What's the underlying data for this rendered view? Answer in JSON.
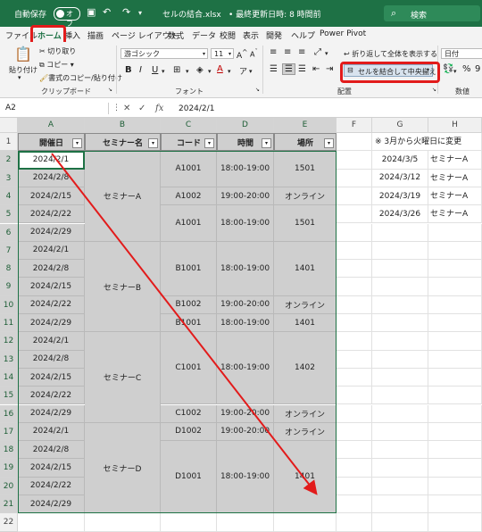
{
  "titlebar": {
    "autosave_label": "自動保存",
    "autosave_state": "オフ",
    "filename": "セルの結合.xlsx",
    "modified": "• 最終更新日時: 8 時間前",
    "search_label": "検索"
  },
  "menu": [
    "ファイル",
    "ホーム",
    "挿入",
    "描画",
    "ページ レイアウト",
    "数式",
    "データ",
    "校閲",
    "表示",
    "開発",
    "ヘルプ",
    "Power Pivot"
  ],
  "ribbon": {
    "paste": "貼り付け",
    "cut": "切り取り",
    "copy": "コピー",
    "format_painter": "書式のコピー/貼り付け",
    "group_clipboard": "クリップボード",
    "font_name": "游ゴシック",
    "font_size": "11",
    "group_font": "フォント",
    "wrap_text": "折り返して全体を表示する",
    "merge_center": "セルを結合して中央揃え",
    "group_alignment": "配置",
    "number_format": "日付",
    "group_number": "数値"
  },
  "formula_bar": {
    "name_box": "A2",
    "formula": "2024/2/1"
  },
  "columns": [
    "A",
    "B",
    "C",
    "D",
    "E",
    "F",
    "G",
    "H"
  ],
  "rows": [
    "1",
    "2",
    "3",
    "4",
    "5",
    "6",
    "7",
    "8",
    "9",
    "10",
    "11",
    "12",
    "13",
    "14",
    "15",
    "16",
    "17",
    "18",
    "19",
    "20",
    "21",
    "22"
  ],
  "headers": [
    "開催日",
    "セミナー名",
    "コード",
    "時間",
    "場所"
  ],
  "dates": [
    "2024/2/1",
    "2024/2/8",
    "2024/2/15",
    "2024/2/22",
    "2024/2/29",
    "2024/2/1",
    "2024/2/8",
    "2024/2/15",
    "2024/2/22",
    "2024/2/29",
    "2024/2/1",
    "2024/2/8",
    "2024/2/15",
    "2024/2/22",
    "2024/2/29",
    "2024/2/1",
    "2024/2/8",
    "2024/2/15",
    "2024/2/22",
    "2024/2/29"
  ],
  "seminars": [
    "セミナーA",
    "セミナーB",
    "セミナーC",
    "セミナーD"
  ],
  "codes": [
    "A1001",
    "A1002",
    "A1001",
    "B1001",
    "B1002",
    "B1001",
    "C1001",
    "C1002",
    "D1002",
    "D1001"
  ],
  "times": [
    "18:00-19:00",
    "19:00-20:00",
    "18:00-19:00",
    "18:00-19:00",
    "19:00-20:00",
    "18:00-19:00",
    "18:00-19:00",
    "19:00-20:00",
    "19:00-20:00",
    "18:00-19:00"
  ],
  "places": [
    "1501",
    "オンライン",
    "1501",
    "1401",
    "オンライン",
    "1401",
    "1402",
    "オンライン",
    "オンライン",
    "1401"
  ],
  "side": {
    "note": "※ 3月から火曜日に変更",
    "dates": [
      "2024/3/5",
      "2024/3/12",
      "2024/3/19",
      "2024/3/26"
    ],
    "names": [
      "セミナーA",
      "セミナーA",
      "セミナーA",
      "セミナーA"
    ]
  },
  "colors": {
    "excel_green": "#1e7145",
    "highlight_red": "#e21b1b",
    "merged_gray": "#cfcfcf"
  }
}
